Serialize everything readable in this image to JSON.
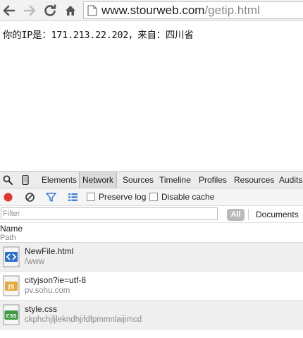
{
  "browser": {
    "url_host": "www.stourweb.com",
    "url_path": "/getip.html"
  },
  "page": {
    "text": "你的IP是：171.213.22.202，来自：四川省"
  },
  "devtools": {
    "tabs": [
      {
        "label": "Elements"
      },
      {
        "label": "Network"
      },
      {
        "label": "Sources"
      },
      {
        "label": "Timeline"
      },
      {
        "label": "Profiles"
      },
      {
        "label": "Resources"
      },
      {
        "label": "Audits"
      }
    ],
    "active_tab": "Network",
    "preserve_log_label": "Preserve log",
    "disable_cache_label": "Disable cache",
    "filter_placeholder": "Filter",
    "all_label": "All",
    "documents_label": "Documents",
    "col_name": "Name",
    "col_path": "Path",
    "requests": [
      {
        "name": "NewFile.html",
        "path": "/www",
        "icon": "html-file-icon"
      },
      {
        "name": "cityjson?ie=utf-8",
        "path": "pv.sohu.com",
        "icon": "js-file-icon"
      },
      {
        "name": "style.css",
        "path": "ckphchjljlekndhjifdfpmmnlaijimcd",
        "icon": "css-file-icon"
      }
    ]
  },
  "colors": {
    "record": "#e33333",
    "filter_icon": "#3f7fd6",
    "html_icon": "#2e6fcf",
    "js_icon": "#e7a93a",
    "css_icon": "#3e9a3e"
  }
}
